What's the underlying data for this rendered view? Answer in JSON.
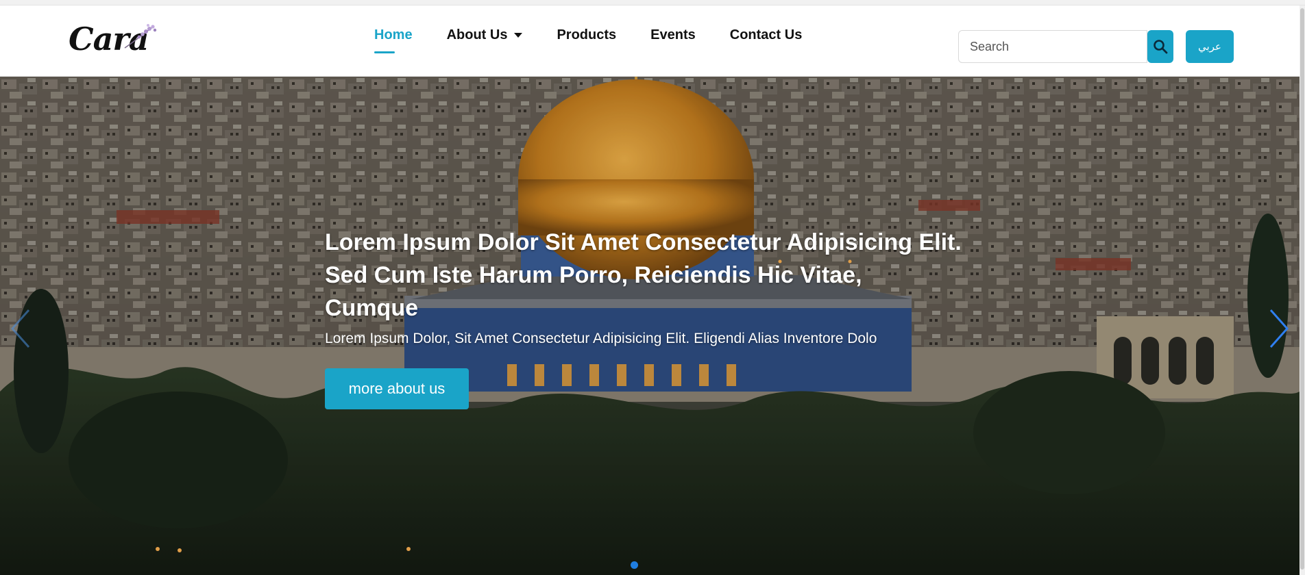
{
  "brand": {
    "logo_text": "Cara",
    "logo_icon": "lavender-sprig-icon"
  },
  "nav": {
    "items": [
      {
        "label": "Home",
        "active": true
      },
      {
        "label": "About Us",
        "has_dropdown": true
      },
      {
        "label": "Products"
      },
      {
        "label": "Events"
      },
      {
        "label": "Contact Us"
      }
    ]
  },
  "search": {
    "placeholder": "Search",
    "button_icon": "search-icon"
  },
  "language_button": {
    "label": "عربي"
  },
  "hero": {
    "title_line1": "Lorem Ipsum Dolor Sit Amet Consectetur Adipisicing Elit.",
    "title_line2": "Sed Cum Iste Harum Porro, Reiciendis Hic Vitae,",
    "title_line3": "Cumque",
    "subtitle": "Lorem Ipsum Dolor, Sit Amet Consectetur Adipisicing Elit. Eligendi Alias Inventore Dolo",
    "button_label": "more about us",
    "prev_icon": "chevron-left-icon",
    "next_icon": "chevron-right-icon",
    "slide_count": 1,
    "active_slide": 1
  },
  "colors": {
    "accent": "#1aa4c8",
    "indicator": "#1f7ee0",
    "text_dark": "#111111"
  }
}
